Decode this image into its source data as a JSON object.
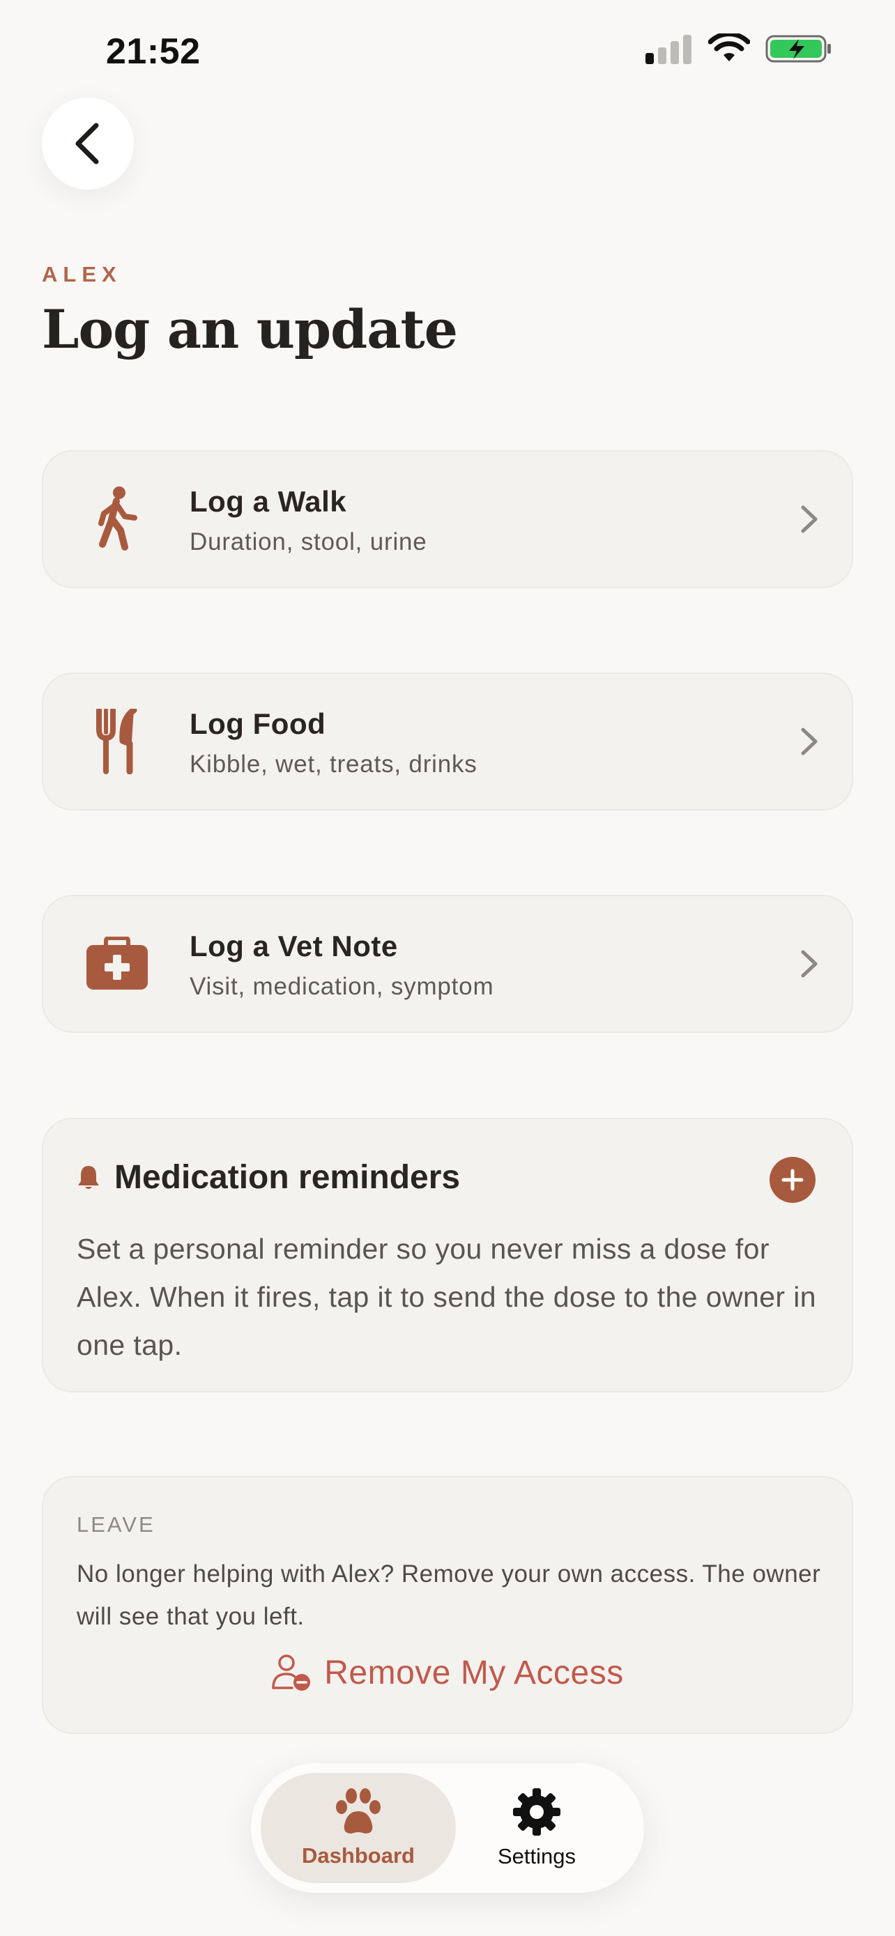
{
  "status_bar": {
    "time": "21:52"
  },
  "header": {
    "back_label": "Back",
    "eyebrow": "ALEX",
    "title": "Log an update"
  },
  "actions": [
    {
      "title": "Log a Walk",
      "subtitle": "Duration, stool, urine",
      "icon": "walking-person-icon"
    },
    {
      "title": "Log Food",
      "subtitle": "Kibble, wet, treats, drinks",
      "icon": "fork-knife-icon"
    },
    {
      "title": "Log a Vet Note",
      "subtitle": "Visit, medication, symptom",
      "icon": "medical-kit-icon"
    }
  ],
  "reminders": {
    "title": "Medication reminders",
    "body": "Set a personal reminder so you never miss a dose for Alex. When it fires, tap it to send the dose to the owner in one tap."
  },
  "leave": {
    "label": "LEAVE",
    "body": "No longer helping with Alex? Remove your own access. The owner will see that you left.",
    "button": "Remove My Access"
  },
  "tabbar": {
    "tabs": [
      {
        "label": "Dashboard",
        "icon": "paw-icon",
        "active": true
      },
      {
        "label": "Settings",
        "icon": "gear-icon",
        "active": false
      }
    ]
  },
  "colors": {
    "accent": "#a85a3e",
    "danger": "#c05a4c",
    "background": "#f9f8f6",
    "card": "#f4f2ef"
  }
}
